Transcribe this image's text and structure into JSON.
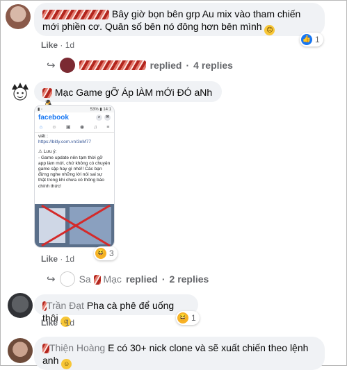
{
  "comments": [
    {
      "text": "Bây giờ bọn bên grp Au mix vào tham chiến mới phiền cơ. Quân số bên nó đông hơn bên mình",
      "like_label": "Like",
      "time": "1d",
      "reaction_count": "1",
      "reaction_icon": "like-icon",
      "replies_label": "replied",
      "replies_count_label": "4 replies"
    },
    {
      "text": "Mạc Game gỠ Áp lÀM mỚi ĐÓ aNh",
      "like_label": "Like",
      "time": "1d",
      "reaction_count": "3",
      "reaction_icon": "haha-icon",
      "replies_name_prefix": "Sa",
      "replies_name_suffix": "Mạc",
      "replies_label": "replied",
      "replies_count_label": "2 replies"
    },
    {
      "name_visible": "Trần Đạt",
      "text": "Pha cà phê để uống thôi",
      "like_label": "Like",
      "time": "1d",
      "reaction_count": "1",
      "reaction_icon": "haha-icon"
    },
    {
      "name_visible": "Thiện Hoàng",
      "text": "E có 30+ nick clone và sẽ xuất chiến theo lệnh anh"
    }
  ],
  "phone": {
    "status_right": "53% ▮ 14:1",
    "logo": "facebook",
    "body_1": "viết :",
    "link": "https://bitly.com.vn/3eM77",
    "warning_title": "⚠ Lưu ý:",
    "body_2": "- Game update nên tạm thời gỡ app làm mới, chứ không có chuyện game sập hay gì nhé!! Các bạn đừng nghe những lời nói sai sự thật trong khi chưa có thông báo chính thức!"
  },
  "colors": {
    "like_blue": "#1877f2",
    "bubble_gray": "#f0f2f5",
    "meta_gray": "#65676b"
  }
}
